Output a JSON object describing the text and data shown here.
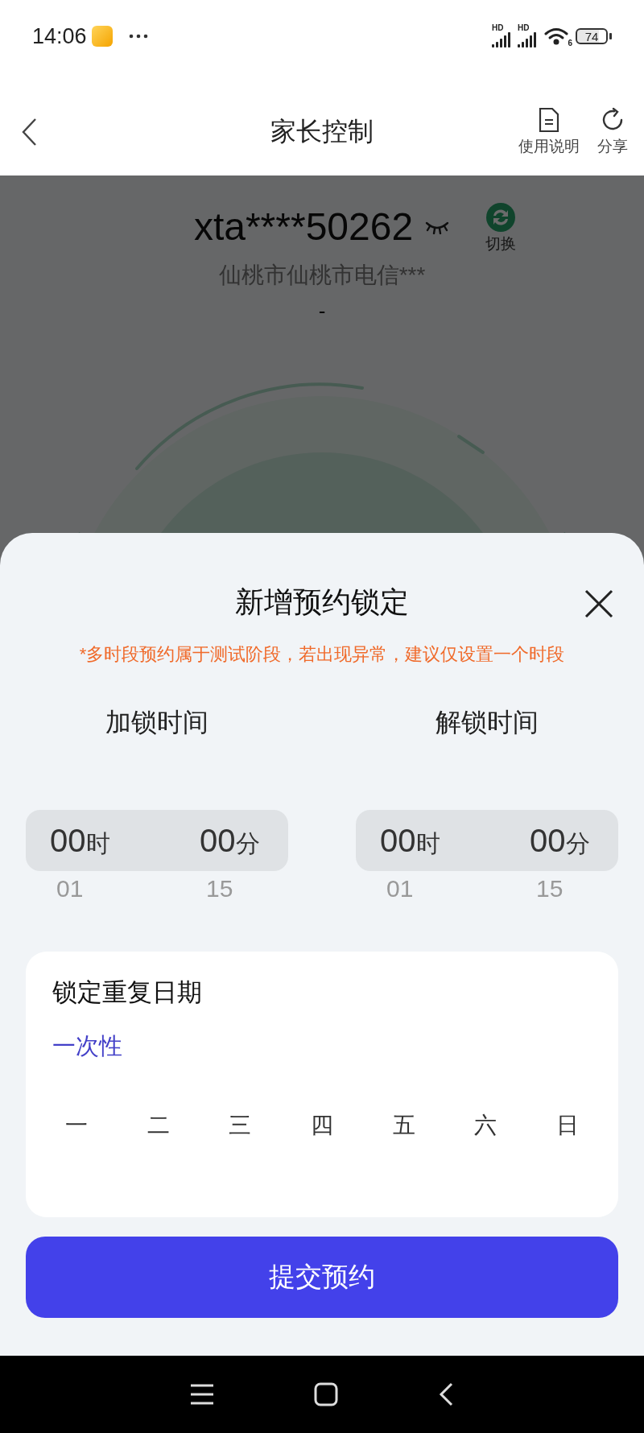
{
  "status_bar": {
    "time": "14:06",
    "signals": [
      {
        "label": "HD"
      },
      {
        "label": "HD"
      }
    ],
    "wifi_label": "6",
    "battery": "74"
  },
  "header": {
    "title": "家长控制",
    "actions": [
      {
        "kind": "doc",
        "label": "使用说明"
      },
      {
        "kind": "share",
        "label": "分享"
      }
    ]
  },
  "account": {
    "name": "xta****50262",
    "switch_label": "切换",
    "location": "仙桃市仙桃市电信***",
    "status": "-"
  },
  "sheet": {
    "title": "新增预约锁定",
    "warning": "*多时段预约属于测试阶段，若出现异常，建议仅设置一个时段",
    "pickers": [
      {
        "label": "加锁时间",
        "hour": {
          "value": "00",
          "unit": "时",
          "next": "01"
        },
        "minute": {
          "value": "00",
          "unit": "分",
          "next": "15"
        }
      },
      {
        "label": "解锁时间",
        "hour": {
          "value": "00",
          "unit": "时",
          "next": "01"
        },
        "minute": {
          "value": "00",
          "unit": "分",
          "next": "15"
        }
      }
    ],
    "repeat": {
      "title": "锁定重复日期",
      "summary": "一次性",
      "days": [
        {
          "label": "一",
          "selected": false
        },
        {
          "label": "二",
          "selected": false
        },
        {
          "label": "三",
          "selected": false
        },
        {
          "label": "四",
          "selected": false
        },
        {
          "label": "五",
          "selected": false
        },
        {
          "label": "六",
          "selected": false
        },
        {
          "label": "日",
          "selected": false
        }
      ]
    },
    "submit": "提交预约"
  }
}
